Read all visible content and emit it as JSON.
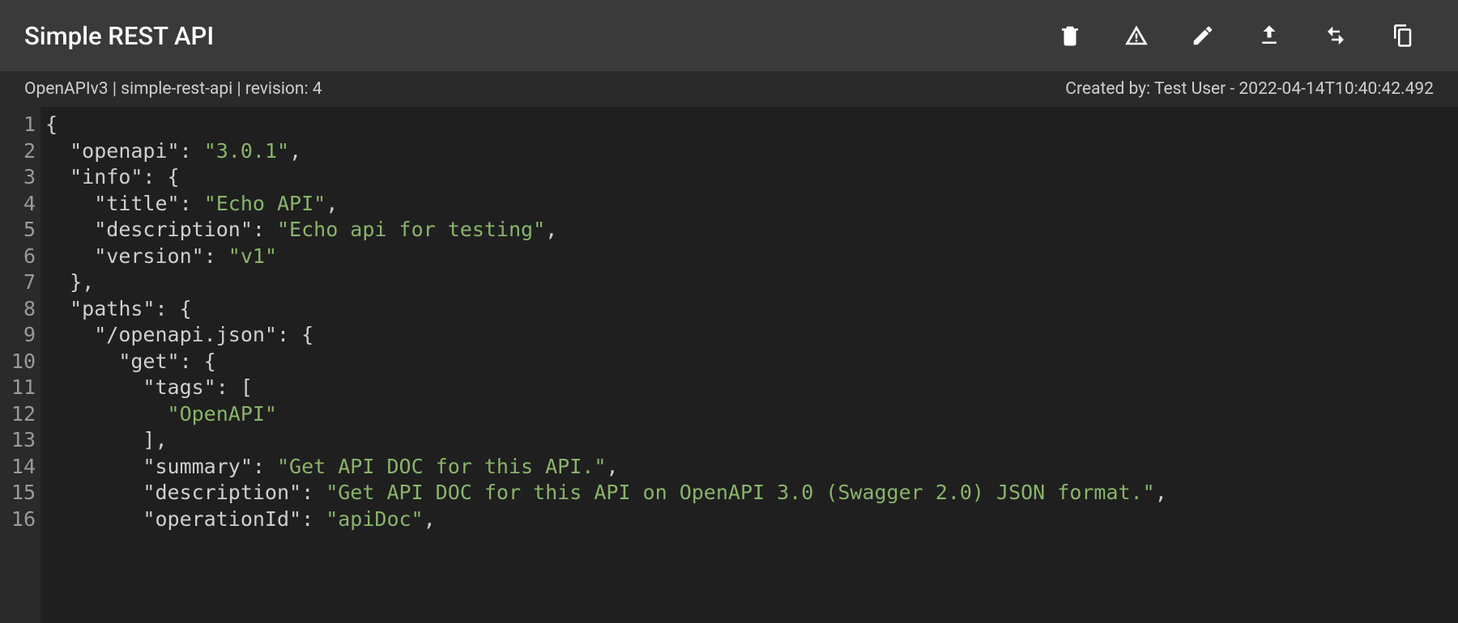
{
  "header": {
    "title": "Simple REST API"
  },
  "toolbar_icons": {
    "delete": "delete",
    "problems": "problems",
    "edit": "edit",
    "upload": "upload",
    "compare": "compare",
    "copy": "copy"
  },
  "meta": {
    "left": "OpenAPIv3 | simple-rest-api | revision: 4",
    "right": "Created by: Test User - 2022-04-14T10:40:42.492"
  },
  "code_lines": [
    [
      {
        "p": "{"
      }
    ],
    [
      {
        "p": "  "
      },
      {
        "k": "\"openapi\""
      },
      {
        "p": ": "
      },
      {
        "s": "\"3.0.1\""
      },
      {
        "p": ","
      }
    ],
    [
      {
        "p": "  "
      },
      {
        "k": "\"info\""
      },
      {
        "p": ": {"
      }
    ],
    [
      {
        "p": "    "
      },
      {
        "k": "\"title\""
      },
      {
        "p": ": "
      },
      {
        "s": "\"Echo API\""
      },
      {
        "p": ","
      }
    ],
    [
      {
        "p": "    "
      },
      {
        "k": "\"description\""
      },
      {
        "p": ": "
      },
      {
        "s": "\"Echo api for testing\""
      },
      {
        "p": ","
      }
    ],
    [
      {
        "p": "    "
      },
      {
        "k": "\"version\""
      },
      {
        "p": ": "
      },
      {
        "s": "\"v1\""
      }
    ],
    [
      {
        "p": "  },"
      }
    ],
    [
      {
        "p": "  "
      },
      {
        "k": "\"paths\""
      },
      {
        "p": ": {"
      }
    ],
    [
      {
        "p": "    "
      },
      {
        "k": "\"/openapi.json\""
      },
      {
        "p": ": {"
      }
    ],
    [
      {
        "p": "      "
      },
      {
        "k": "\"get\""
      },
      {
        "p": ": {"
      }
    ],
    [
      {
        "p": "        "
      },
      {
        "k": "\"tags\""
      },
      {
        "p": ": ["
      }
    ],
    [
      {
        "p": "          "
      },
      {
        "s": "\"OpenAPI\""
      }
    ],
    [
      {
        "p": "        ],"
      }
    ],
    [
      {
        "p": "        "
      },
      {
        "k": "\"summary\""
      },
      {
        "p": ": "
      },
      {
        "s": "\"Get API DOC for this API.\""
      },
      {
        "p": ","
      }
    ],
    [
      {
        "p": "        "
      },
      {
        "k": "\"description\""
      },
      {
        "p": ": "
      },
      {
        "s": "\"Get API DOC for this API on OpenAPI 3.0 (Swagger 2.0) JSON format.\""
      },
      {
        "p": ","
      }
    ],
    [
      {
        "p": "        "
      },
      {
        "k": "\"operationId\""
      },
      {
        "p": ": "
      },
      {
        "s": "\"apiDoc\""
      },
      {
        "p": ","
      }
    ]
  ]
}
